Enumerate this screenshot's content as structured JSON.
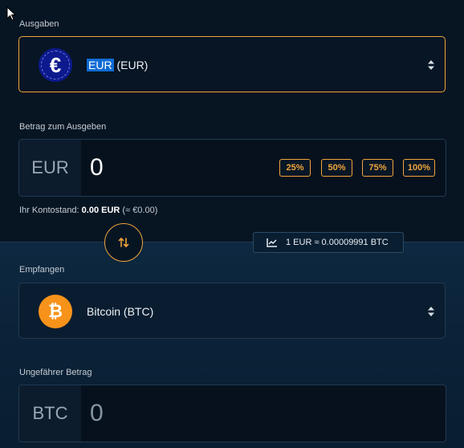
{
  "spend": {
    "label": "Ausgaben",
    "currency_code": "EUR",
    "currency_rest": " (EUR)",
    "icon": "euro-icon"
  },
  "spend_amount": {
    "label": "Betrag zum Ausgeben",
    "currency": "EUR",
    "value": "0",
    "percent_buttons": [
      "25%",
      "50%",
      "75%",
      "100%"
    ]
  },
  "balance": {
    "prefix": "Ihr Kontostand: ",
    "amount": "0.00 EUR",
    "approx": " (≈ €0.00)"
  },
  "rate": {
    "text": "1 EUR ≈ 0.00009991 BTC",
    "icon": "chart-icon"
  },
  "receive": {
    "label": "Empfangen",
    "currency": "Bitcoin (BTC)",
    "icon": "bitcoin-icon"
  },
  "receive_amount": {
    "label": "Ungefährer Betrag",
    "currency": "BTC",
    "value": "0"
  },
  "colors": {
    "accent": "#f0a43a",
    "background": "#071523",
    "euro": "#0d1a8e",
    "bitcoin": "#f7931a"
  }
}
